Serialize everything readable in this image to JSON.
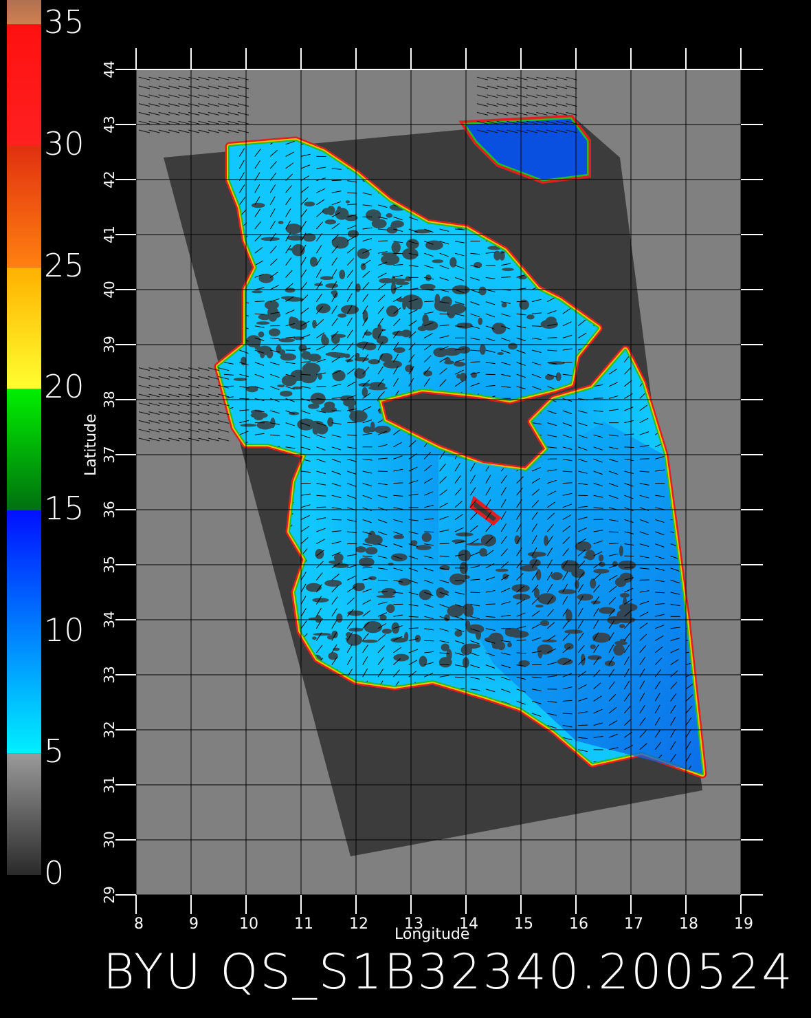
{
  "title": "BYU QS_S1B32340.200524",
  "colorbar": {
    "labels": [
      "35",
      "30",
      "25",
      "20",
      "15",
      "10",
      "5",
      "0"
    ],
    "bands": [
      {
        "from": 0,
        "to": 5,
        "top": "#9a9a9a",
        "bottom": "#2a2a2a"
      },
      {
        "from": 5,
        "to": 15,
        "top": "#0010ff",
        "bottom": "#00f0ff"
      },
      {
        "from": 15,
        "to": 20,
        "top": "#00f000",
        "bottom": "#007010"
      },
      {
        "from": 20,
        "to": 25,
        "top": "#ffb000",
        "bottom": "#ffff30"
      },
      {
        "from": 25,
        "to": 30,
        "top": "#e03010",
        "bottom": "#ff8010"
      },
      {
        "from": 30,
        "to": 35,
        "top": "#ff1010",
        "bottom": "#ff2020"
      },
      {
        "from": 35,
        "to": 36,
        "top": "#b07050",
        "bottom": "#d08050"
      }
    ]
  },
  "map": {
    "x_axis_label": "Longitude",
    "y_axis_label": "Latitude",
    "lon_ticks": [
      "8",
      "9",
      "10",
      "11",
      "12",
      "13",
      "14",
      "15",
      "16",
      "17",
      "18",
      "19"
    ],
    "lat_ticks": [
      "29",
      "30",
      "31",
      "32",
      "33",
      "34",
      "35",
      "36",
      "37",
      "38",
      "39",
      "40",
      "41",
      "42",
      "43",
      "44"
    ],
    "lon_range": [
      8,
      19
    ],
    "lat_range": [
      29,
      44
    ],
    "colors": {
      "background": "#000000",
      "land": "#808080",
      "swath": "#3c3c3c",
      "sea_light": "#10c8ff",
      "sea_mid": "#0a8cf0",
      "sea_deep": "#0a50e0",
      "calm": "#3a3a3a",
      "grid": "#000000",
      "coast_outer": "#e02020",
      "coast_mid": "#ffc000",
      "coast_inner": "#20c020"
    }
  }
}
